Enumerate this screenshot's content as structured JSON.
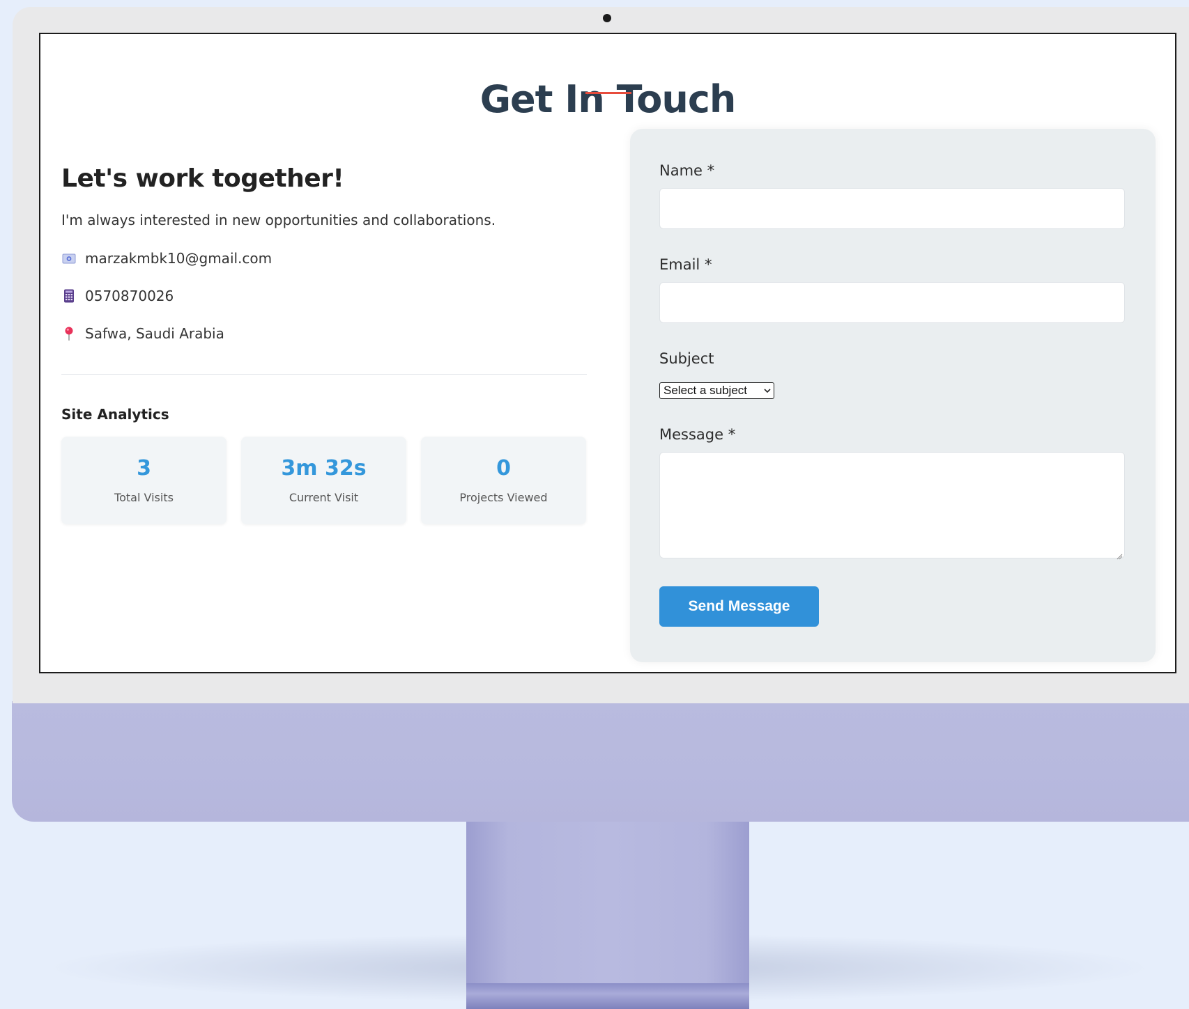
{
  "page": {
    "title": "Get In Touch",
    "title_underline_color": "#e74c3c"
  },
  "intro": {
    "heading": "Let's work together!",
    "text": "I'm always interested in new opportunities and collaborations."
  },
  "contact": {
    "email": {
      "icon": "envelope-icon",
      "value": "marzakmbk10@gmail.com"
    },
    "phone": {
      "icon": "phone-icon",
      "value": "0570870026"
    },
    "location": {
      "icon": "pin-icon",
      "value": "Safwa, Saudi Arabia"
    }
  },
  "analytics": {
    "heading": "Site Analytics",
    "accent_color": "#3497db",
    "cards": [
      {
        "value": "3",
        "label": "Total Visits"
      },
      {
        "value": "3m 32s",
        "label": "Current Visit"
      },
      {
        "value": "0",
        "label": "Projects Viewed"
      }
    ]
  },
  "form": {
    "name_label": "Name *",
    "name_value": "",
    "email_label": "Email *",
    "email_value": "",
    "subject_label": "Subject",
    "subject_selected": "Select a subject",
    "message_label": "Message *",
    "message_value": "",
    "submit_label": "Send Message",
    "button_color": "#3191d9"
  }
}
